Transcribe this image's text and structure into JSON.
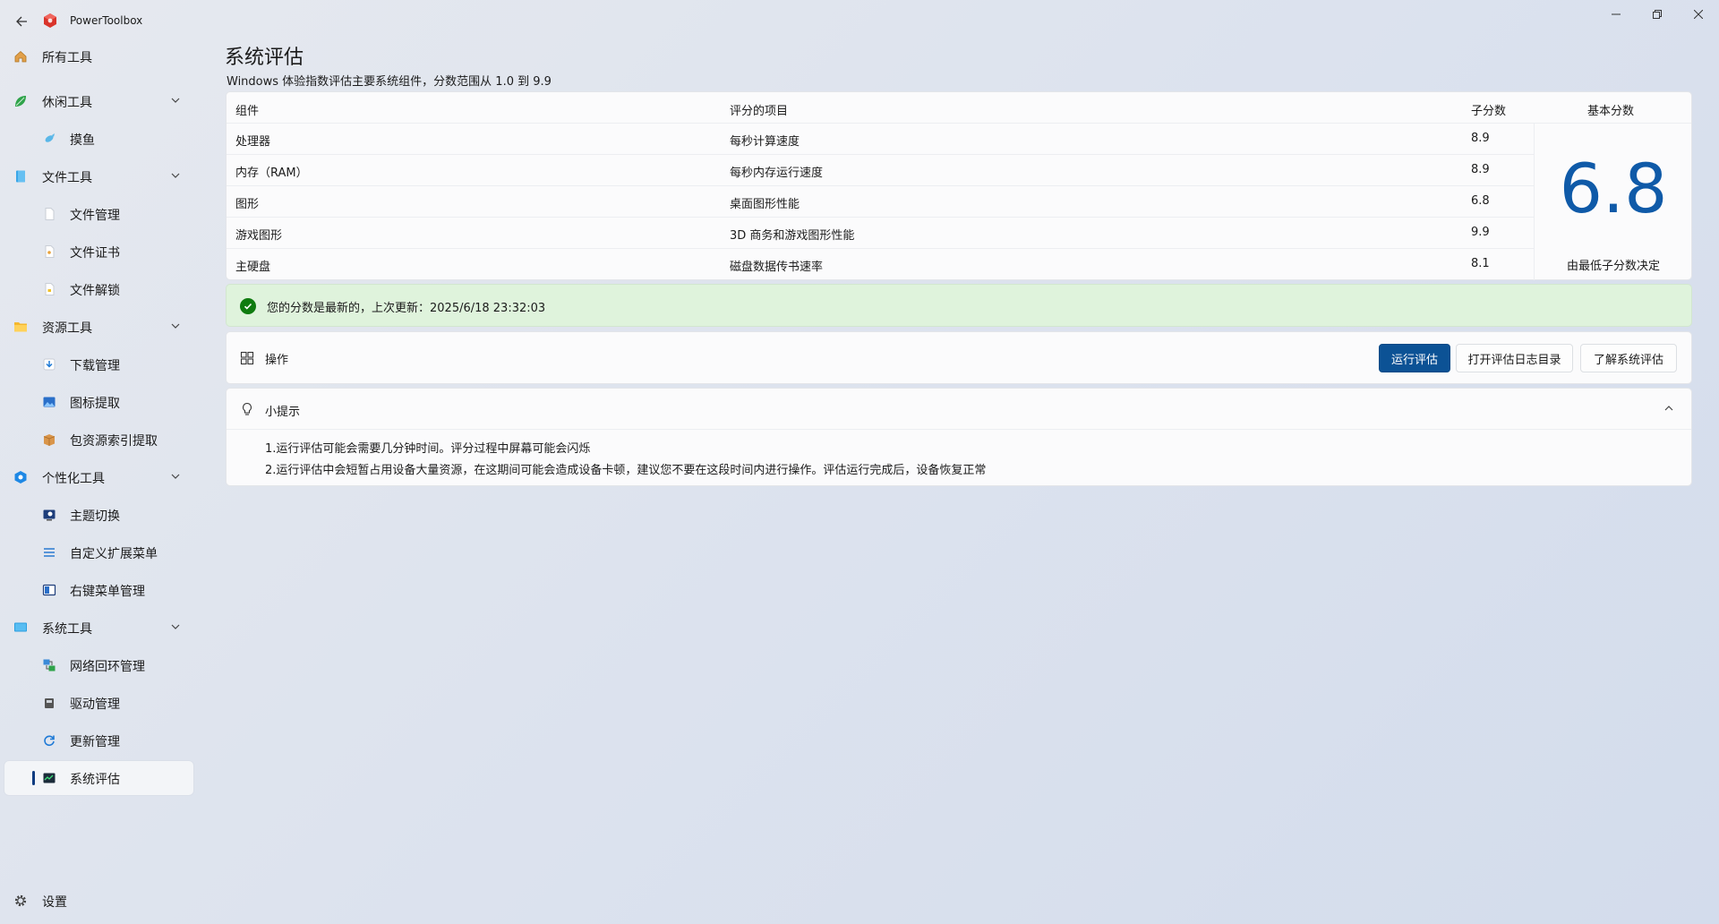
{
  "app": {
    "title": "PowerToolbox"
  },
  "sidebar": {
    "items": [
      {
        "label": "所有工具",
        "icon": "home-icon"
      },
      {
        "label": "休闲工具",
        "icon": "leaf-icon",
        "expandable": true
      },
      {
        "label": "摸鱼",
        "icon": "fish-icon"
      },
      {
        "label": "文件工具",
        "icon": "file-tools-icon",
        "expandable": true
      },
      {
        "label": "文件管理",
        "icon": "document-icon"
      },
      {
        "label": "文件证书",
        "icon": "certificate-icon"
      },
      {
        "label": "文件解锁",
        "icon": "unlock-file-icon"
      },
      {
        "label": "资源工具",
        "icon": "folder-icon",
        "expandable": true
      },
      {
        "label": "下载管理",
        "icon": "download-icon"
      },
      {
        "label": "图标提取",
        "icon": "image-icon"
      },
      {
        "label": "包资源索引提取",
        "icon": "package-icon"
      },
      {
        "label": "个性化工具",
        "icon": "personalize-icon",
        "expandable": true
      },
      {
        "label": "主题切换",
        "icon": "theme-icon"
      },
      {
        "label": "自定义扩展菜单",
        "icon": "menu-list-icon"
      },
      {
        "label": "右键菜单管理",
        "icon": "context-menu-icon"
      },
      {
        "label": "系统工具",
        "icon": "monitor-icon",
        "expandable": true
      },
      {
        "label": "网络回环管理",
        "icon": "network-icon"
      },
      {
        "label": "驱动管理",
        "icon": "driver-icon"
      },
      {
        "label": "更新管理",
        "icon": "update-icon"
      },
      {
        "label": "系统评估",
        "icon": "assessment-icon",
        "selected": true
      }
    ],
    "settings_label": "设置"
  },
  "main": {
    "title": "系统评估",
    "subtitle": "Windows 体验指数评估主要系统组件，分数范围从 1.0 到 9.9",
    "table": {
      "headers": {
        "component": "组件",
        "item": "评分的项目",
        "subscore": "子分数",
        "basescore": "基本分数"
      },
      "rows": [
        {
          "component": "处理器",
          "item": "每秒计算速度",
          "subscore": "8.9"
        },
        {
          "component": "内存（RAM）",
          "item": "每秒内存运行速度",
          "subscore": "8.9"
        },
        {
          "component": "图形",
          "item": "桌面图形性能",
          "subscore": "6.8"
        },
        {
          "component": "游戏图形",
          "item": "3D 商务和游戏图形性能",
          "subscore": "9.9"
        },
        {
          "component": "主硬盘",
          "item": "磁盘数据传书速率",
          "subscore": "8.1"
        }
      ],
      "base_score": "6.8",
      "base_note": "由最低子分数决定"
    },
    "status": {
      "text": "您的分数是最新的，上次更新：2025/6/18 23:32:03",
      "color": "#0f7b0f"
    },
    "operations": {
      "label": "操作",
      "run_button": "运行评估",
      "open_log_button": "打开评估日志目录",
      "learn_button": "了解系统评估"
    },
    "tips": {
      "title": "小提示",
      "lines": [
        "1.运行评估可能会需要几分钟时间。评分过程中屏幕可能会闪烁",
        "2.运行评估中会短暂占用设备大量资源，在这期间可能会造成设备卡顿，建议您不要在这段时间内进行操作。评估运行完成后，设备恢复正常"
      ]
    }
  },
  "colors": {
    "accent": "#0c5295",
    "score": "#0f5aa8",
    "success_bg": "#dff3dc"
  }
}
